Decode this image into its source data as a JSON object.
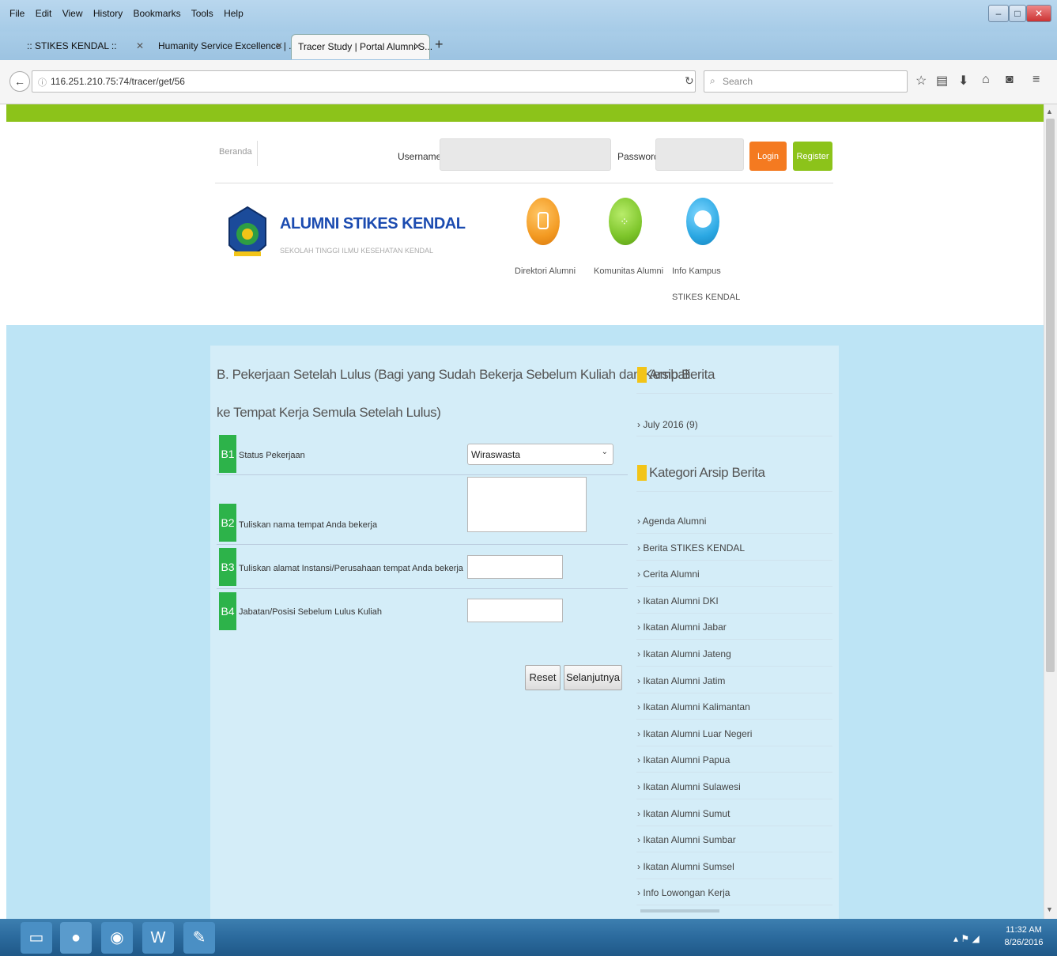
{
  "browser": {
    "menu": [
      "File",
      "Edit",
      "View",
      "History",
      "Bookmarks",
      "Tools",
      "Help"
    ],
    "tabs": [
      {
        "label": ":: STIKES KENDAL ::"
      },
      {
        "label": "Humanity Service Excellence | ..."
      },
      {
        "label": "Tracer Study | Portal Alumni S..."
      }
    ],
    "url": "116.251.210.75:74/tracer/get/56",
    "search_placeholder": "Search"
  },
  "header": {
    "beranda": "Beranda",
    "username_label": "Username",
    "password_label": "Password",
    "login_label": "Login",
    "register_label": "Register",
    "site_title": "ALUMNI STIKES KENDAL",
    "site_subtitle": "SEKOLAH TINGGI ILMU KESEHATAN KENDAL",
    "nav": [
      {
        "label": "Direktori Alumni",
        "color": "#f39a22"
      },
      {
        "label": "Komunitas Alumni",
        "color": "#7dc52a"
      },
      {
        "label": "Info Kampus",
        "sub": "STIKES KENDAL",
        "color": "#2ba8e3"
      }
    ]
  },
  "form": {
    "heading": "B. Pekerjaan Setelah Lulus (Bagi yang Sudah Bekerja Sebelum Kuliah dan Kembali ke Tempat Kerja Semula Setelah Lulus)",
    "heading_line1": "B. Pekerjaan Setelah Lulus (Bagi yang Sudah Bekerja Sebelum Kuliah dan Kembali",
    "heading_line2": "ke Tempat Kerja Semula Setelah Lulus)",
    "rows": [
      {
        "code": "B1",
        "label": "Status Pekerjaan",
        "value": "Wiraswasta"
      },
      {
        "code": "B2",
        "label": "Tuliskan nama tempat Anda bekerja",
        "value": ""
      },
      {
        "code": "B3",
        "label": "Tuliskan alamat Instansi/Perusahaan tempat Anda bekerja",
        "value": ""
      },
      {
        "code": "B4",
        "label": "Jabatan/Posisi Sebelum Lulus Kuliah",
        "value": ""
      }
    ],
    "reset_label": "Reset",
    "next_label": "Selanjutnya"
  },
  "sidebar": {
    "archive_title": "Arsip Berita",
    "archive_items": [
      "July 2016 (9)"
    ],
    "category_title": "Kategori Arsip Berita",
    "categories": [
      "Agenda Alumni",
      "Berita STIKES KENDAL",
      "Cerita Alumni",
      "Ikatan Alumni DKI",
      "Ikatan Alumni Jabar",
      "Ikatan Alumni Jateng",
      "Ikatan Alumni Jatim",
      "Ikatan Alumni Kalimantan",
      "Ikatan Alumni Luar Negeri",
      "Ikatan Alumni Papua",
      "Ikatan Alumni Sulawesi",
      "Ikatan Alumni Sumut",
      "Ikatan Alumni Sumbar",
      "Ikatan Alumni Sumsel",
      "Info Lowongan Kerja"
    ]
  },
  "taskbar": {
    "time": "11:32 AM",
    "date": "8/26/2016"
  }
}
